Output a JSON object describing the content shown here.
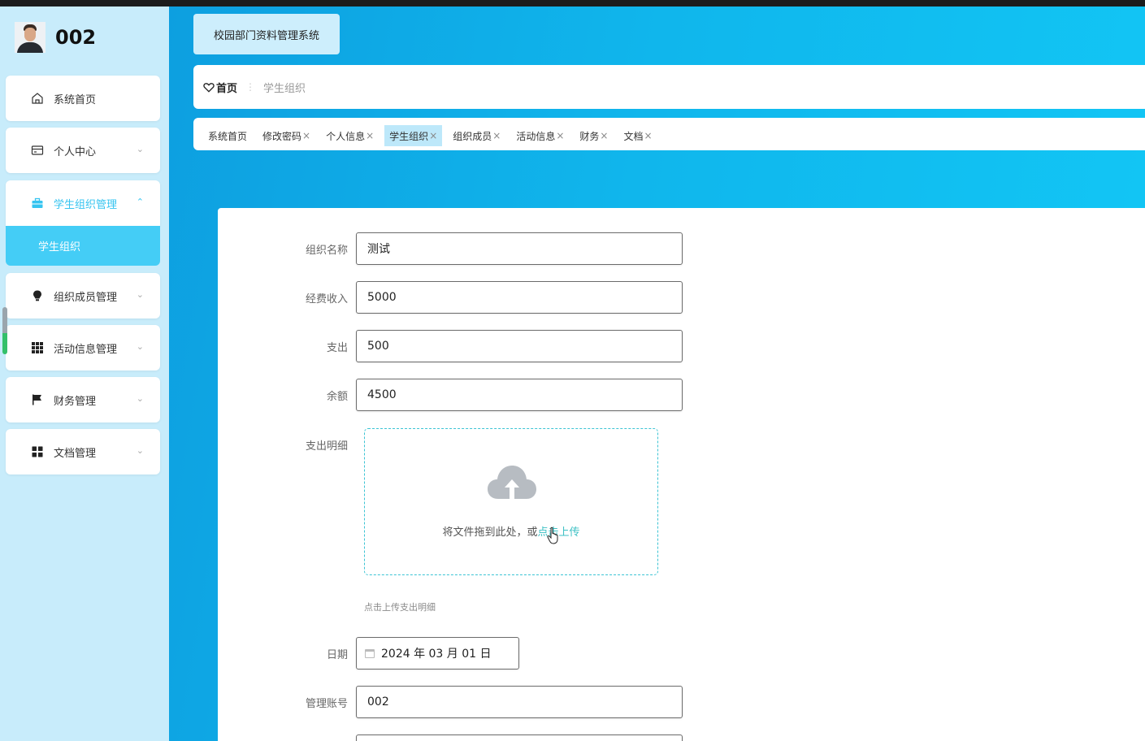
{
  "user": {
    "name": "002"
  },
  "sidebar": {
    "items": [
      {
        "label": "系统首页",
        "icon": "home-icon"
      },
      {
        "label": "个人中心",
        "icon": "card-icon"
      },
      {
        "label": "学生组织管理",
        "icon": "briefcase-icon",
        "active": true,
        "sub": [
          "学生组织"
        ]
      },
      {
        "label": "组织成员管理",
        "icon": "bulb-icon"
      },
      {
        "label": "活动信息管理",
        "icon": "grid-icon"
      },
      {
        "label": "财务管理",
        "icon": "flag-icon"
      },
      {
        "label": "文档管理",
        "icon": "apps-icon"
      }
    ]
  },
  "header": {
    "app_title": "校园部门资料管理系统"
  },
  "breadcrumb": {
    "home": "首页",
    "current": "学生组织"
  },
  "tags": [
    {
      "label": "系统首页"
    },
    {
      "label": "修改密码"
    },
    {
      "label": "个人信息"
    },
    {
      "label": "学生组织",
      "active": true
    },
    {
      "label": "组织成员"
    },
    {
      "label": "活动信息"
    },
    {
      "label": "财务"
    },
    {
      "label": "文档"
    }
  ],
  "form": {
    "org_name": {
      "label": "组织名称",
      "value": "测试"
    },
    "income": {
      "label": "经费收入",
      "value": "5000"
    },
    "expense": {
      "label": "支出",
      "value": "500"
    },
    "balance": {
      "label": "余额",
      "value": "4500"
    },
    "expense_detail": {
      "label": "支出明细",
      "upload_text": "将文件拖到此处，或",
      "upload_link": "点击上传",
      "hint": "点击上传支出明细"
    },
    "date": {
      "label": "日期",
      "value": "2024 年 03 月 01 日"
    },
    "account": {
      "label": "管理账号",
      "value": "002"
    }
  },
  "colors": {
    "accent": "#36c4f0",
    "sidebar_bg": "#c8ecfb",
    "main_bg": "#10b6ec",
    "upload_border": "#3cc4d4"
  }
}
